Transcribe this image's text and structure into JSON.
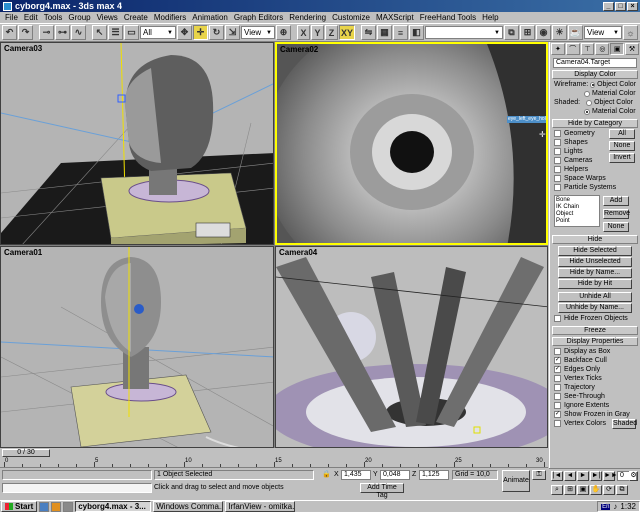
{
  "window": {
    "title": "cyborg4.max - 3ds max 4",
    "controls": [
      "_",
      "□",
      "×"
    ]
  },
  "menu": [
    "File",
    "Edit",
    "Tools",
    "Group",
    "Views",
    "Create",
    "Modifiers",
    "Animation",
    "Graph Editors",
    "Rendering",
    "Customize",
    "MAXScript",
    "FreeHand Tools",
    "Help"
  ],
  "toolbar": {
    "selection_filter": "All",
    "ref_coord": "View",
    "axes": [
      "X",
      "Y",
      "Z",
      "XY"
    ],
    "view_dropdown": "View"
  },
  "viewports": {
    "top_left": "Camera03",
    "top_right": "Camera02",
    "bottom_left": "Camera01",
    "bottom_right": "Camera04",
    "tooltip": "eye_left_eye_hole"
  },
  "command_panel": {
    "object_name": "Camera04.Target",
    "display_color": {
      "title": "Display Color",
      "wireframe_label": "Wireframe:",
      "shaded_label": "Shaded:",
      "object_color": "Object Color",
      "material_color": "Material Color"
    },
    "hide_by_category": {
      "title": "Hide by Category",
      "items": [
        "Geometry",
        "Shapes",
        "Lights",
        "Cameras",
        "Helpers",
        "Space Warps",
        "Particle Systems"
      ],
      "btn_all": "All",
      "btn_none": "None",
      "btn_invert": "Invert",
      "list": [
        "Bone",
        "IK Chain Object",
        "Point"
      ],
      "btn_add": "Add",
      "btn_remove": "Remove",
      "btn_none2": "None"
    },
    "hide": {
      "title": "Hide",
      "buttons": [
        "Hide Selected",
        "Hide Unselected",
        "Hide by Name...",
        "Hide by Hit",
        "Unhide All",
        "Unhide by Name..."
      ],
      "hide_frozen": "Hide Frozen Objects"
    },
    "freeze_title": "Freeze",
    "display_properties": {
      "title": "Display Properties",
      "items": [
        {
          "label": "Display as Box",
          "checked": false
        },
        {
          "label": "Backface Cull",
          "checked": true
        },
        {
          "label": "Edges Only",
          "checked": true
        },
        {
          "label": "Vertex Ticks",
          "checked": false
        },
        {
          "label": "Trajectory",
          "checked": false
        },
        {
          "label": "See-Through",
          "checked": false
        },
        {
          "label": "Ignore Extents",
          "checked": false
        },
        {
          "label": "Show Frozen in Gray",
          "checked": true
        },
        {
          "label": "Vertex Colors",
          "checked": false
        }
      ],
      "shaded_btn": "Shaded"
    }
  },
  "timeline": {
    "slider_text": "0 / 30",
    "ticks": [
      "0",
      "5",
      "10",
      "15",
      "20",
      "25",
      "30"
    ]
  },
  "status": {
    "selection": "1 Object Selected",
    "prompt": "Click and drag to select and move objects",
    "x_label": "X",
    "x_value": "1,435",
    "y_label": "Y",
    "y_value": "0,048",
    "z_label": "Z",
    "z_value": "1,125",
    "grid": "Grid = 10,0",
    "add_time_tag": "Add Time Tag",
    "animate": "Animate"
  },
  "anim_controls": {
    "frame": "0",
    "buttons": [
      "|◄",
      "◄",
      "►",
      "►|",
      "►►"
    ]
  },
  "taskbar": {
    "start": "Start",
    "tasks": [
      {
        "label": "cyborg4.max - 3...",
        "active": true
      },
      {
        "label": "Windows Comma...",
        "active": false
      },
      {
        "label": "IrfanView - omitka...",
        "active": false
      }
    ],
    "lang": "En",
    "clock": "1:32"
  }
}
